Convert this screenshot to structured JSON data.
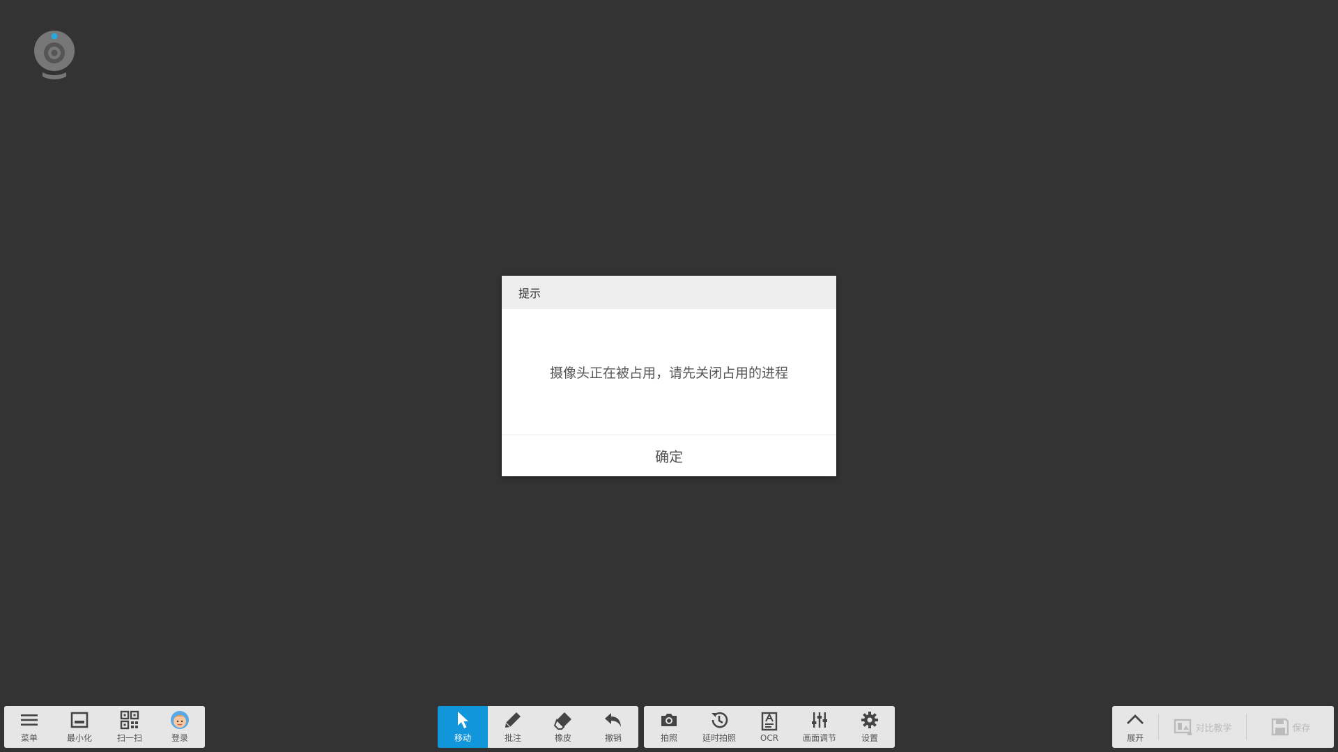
{
  "dialog": {
    "title": "提示",
    "message": "摄像头正在被占用，请先关闭占用的进程",
    "ok_label": "确定"
  },
  "toolbar_left": [
    {
      "label": "菜单",
      "icon": "menu-icon"
    },
    {
      "label": "最小化",
      "icon": "minimize-icon"
    },
    {
      "label": "扫一扫",
      "icon": "qrcode-icon"
    },
    {
      "label": "登录",
      "icon": "avatar-icon"
    }
  ],
  "toolbar_draw": [
    {
      "label": "移动",
      "icon": "pointer-icon",
      "active": true
    },
    {
      "label": "批注",
      "icon": "pen-icon"
    },
    {
      "label": "橡皮",
      "icon": "eraser-icon"
    },
    {
      "label": "撤销",
      "icon": "undo-icon"
    }
  ],
  "toolbar_camera": [
    {
      "label": "拍照",
      "icon": "camera-icon"
    },
    {
      "label": "延时拍照",
      "icon": "timer-icon"
    },
    {
      "label": "OCR",
      "icon": "ocr-icon"
    },
    {
      "label": "画面调节",
      "icon": "sliders-icon"
    },
    {
      "label": "设置",
      "icon": "gear-icon"
    }
  ],
  "toolbar_right": [
    {
      "label": "展开",
      "icon": "chevron-up-icon"
    },
    {
      "label": "对比教学",
      "icon": "compare-icon",
      "disabled": true
    },
    {
      "label": "保存",
      "icon": "save-icon",
      "disabled": true
    }
  ],
  "colors": {
    "background": "#333333",
    "accent": "#1296db",
    "toolbar_bg": "#e6e6e6",
    "logo_dot": "#29a8e0"
  }
}
